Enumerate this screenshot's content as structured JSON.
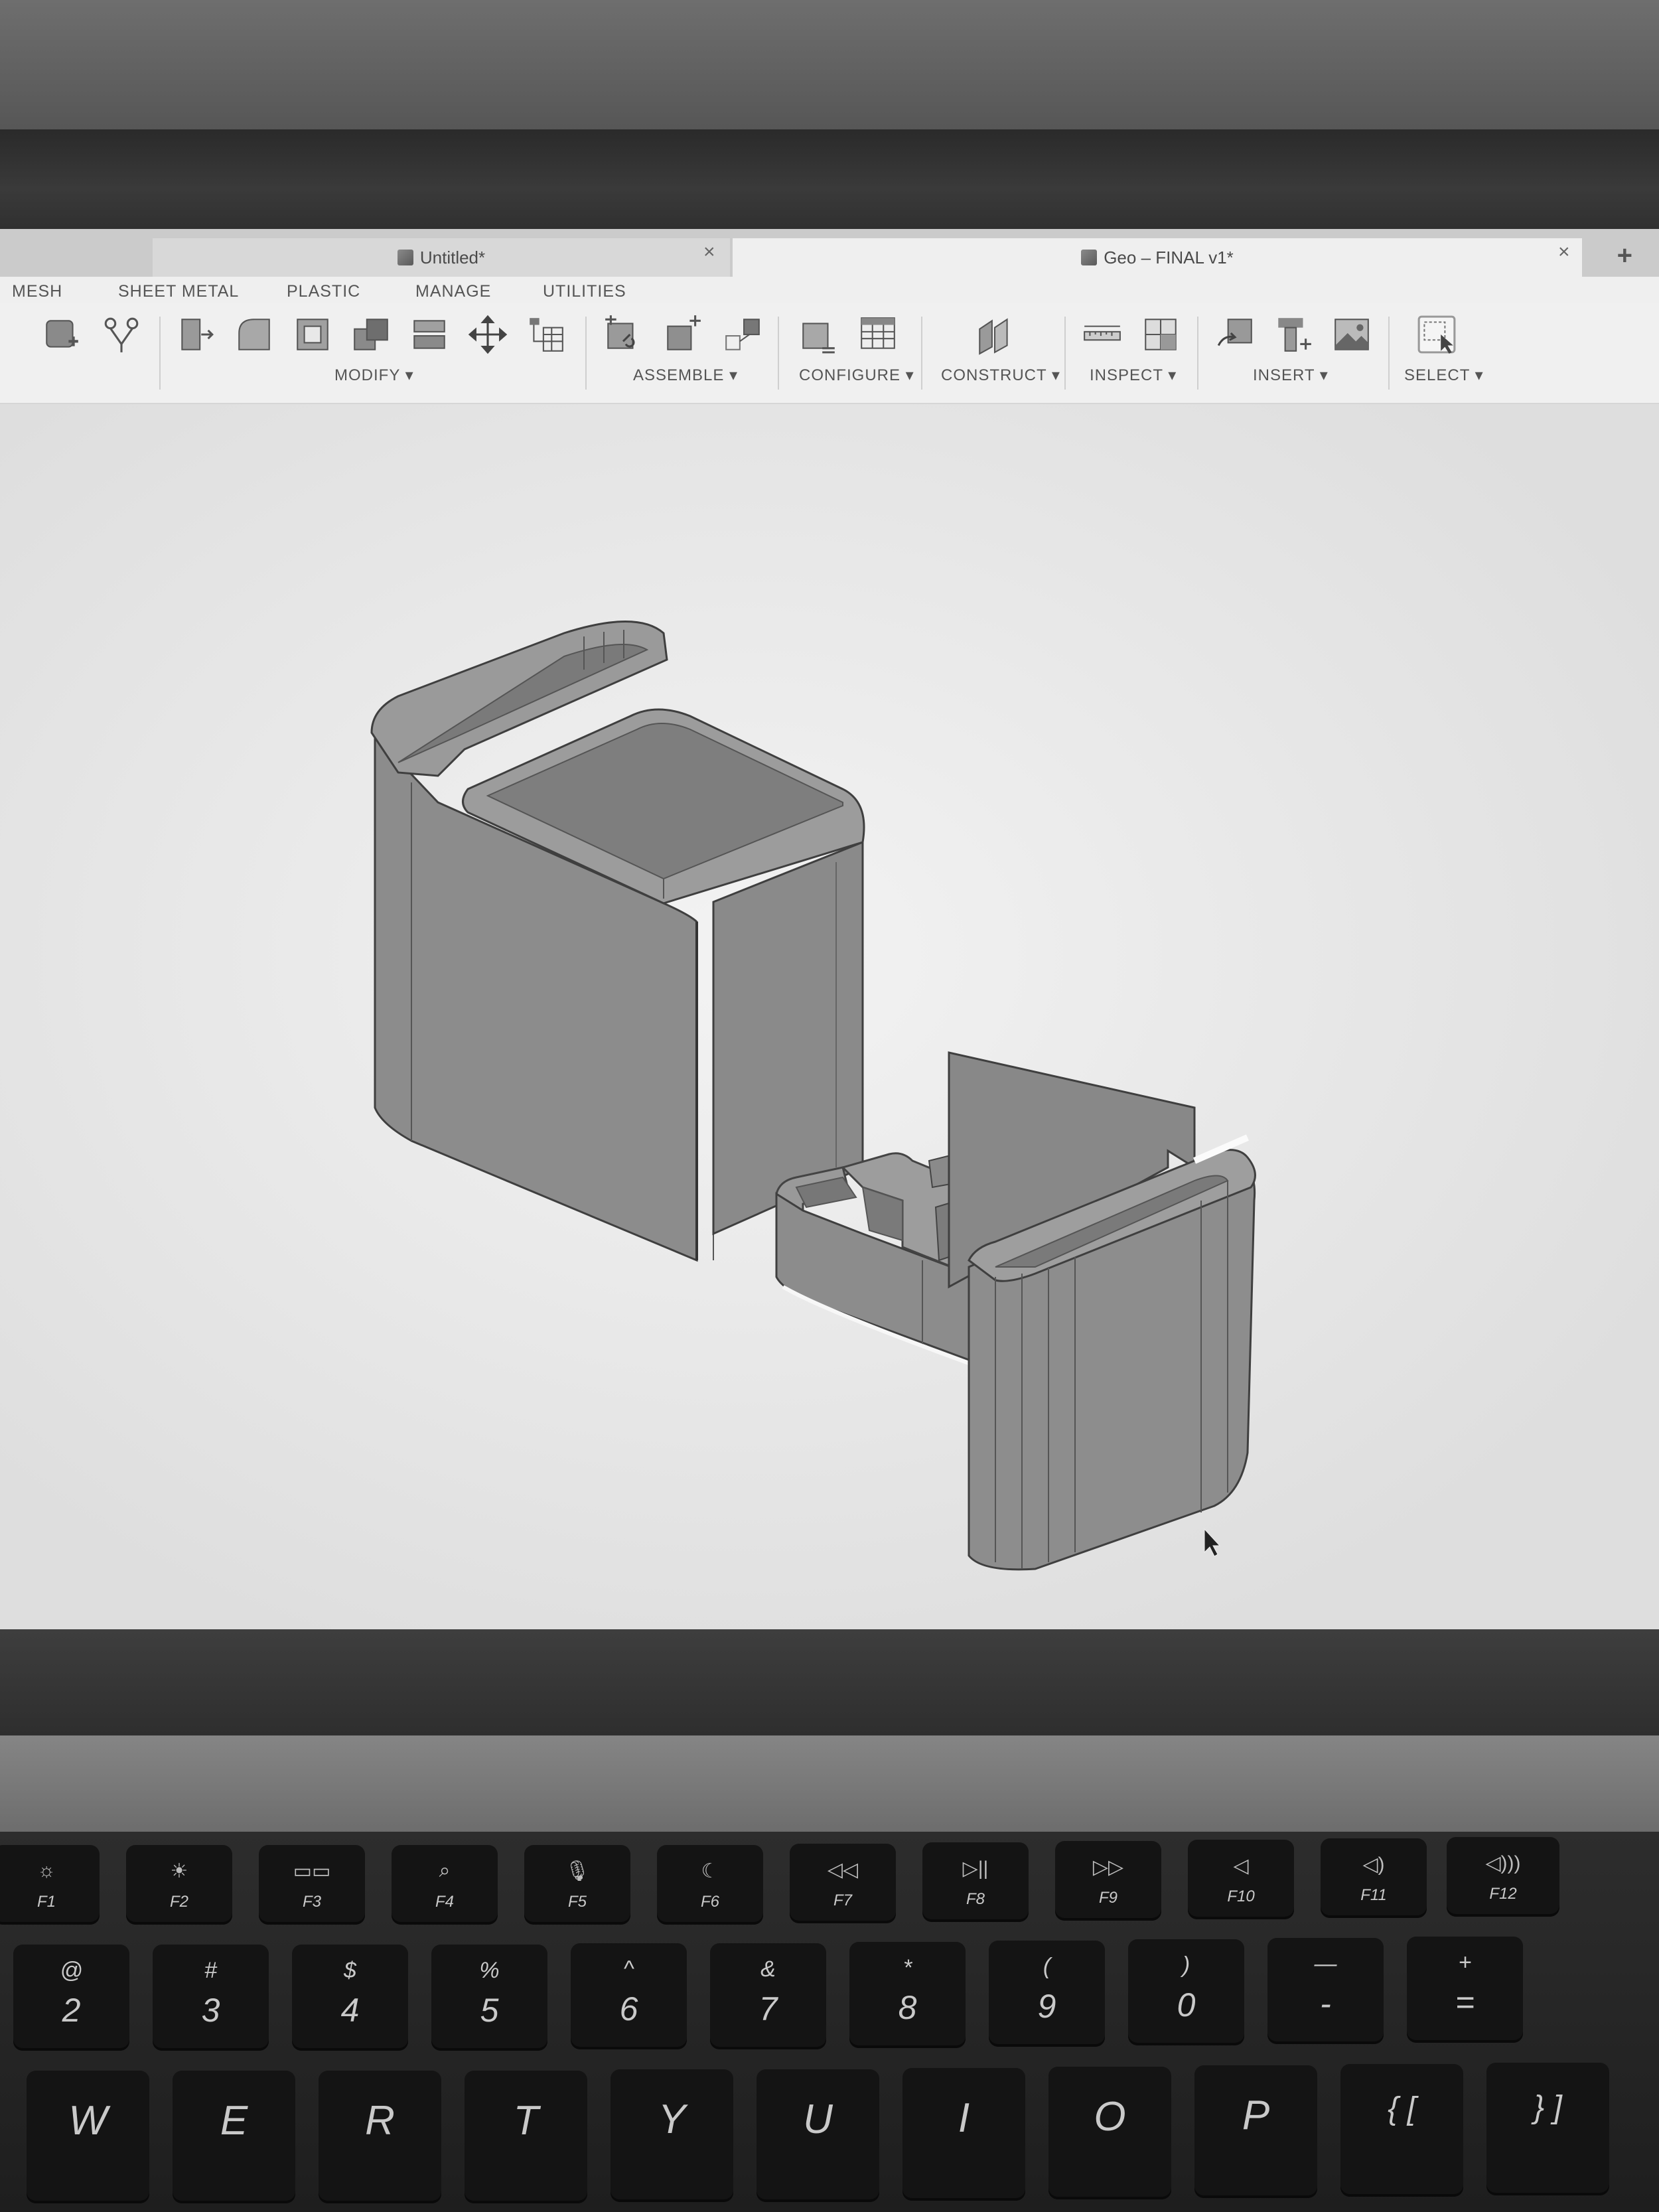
{
  "document_tabs": [
    {
      "title": "Untitled*",
      "active": false,
      "close_icon": "×"
    },
    {
      "title": "Geo – FINAL v1*",
      "active": true,
      "close_icon": "×"
    }
  ],
  "new_tab_icon": "+",
  "menu_tabs": [
    "MESH",
    "SHEET METAL",
    "PLASTIC",
    "MANAGE",
    "UTILITIES"
  ],
  "toolbar_groups": {
    "modify": "MODIFY ▾",
    "assemble": "ASSEMBLE ▾",
    "configure": "CONFIGURE ▾",
    "construct": "CONSTRUCT ▾",
    "inspect": "INSPECT ▾",
    "insert": "INSERT ▾",
    "select": "SELECT ▾"
  },
  "browser_add": "+",
  "navigation_icons": [
    "orbit",
    "look-at",
    "pan",
    "zoom",
    "fit",
    "display-settings",
    "grid",
    "viewports"
  ],
  "function_keys": [
    {
      "label": "F1",
      "glyph": "☼"
    },
    {
      "label": "F2",
      "glyph": "☀"
    },
    {
      "label": "F3",
      "glyph": "▭▭"
    },
    {
      "label": "F4",
      "glyph": "⌕"
    },
    {
      "label": "F5",
      "glyph": "🎙"
    },
    {
      "label": "F6",
      "glyph": "☾"
    },
    {
      "label": "F7",
      "glyph": "◁◁"
    },
    {
      "label": "F8",
      "glyph": "▷||"
    },
    {
      "label": "F9",
      "glyph": "▷▷"
    },
    {
      "label": "F10",
      "glyph": "◁"
    },
    {
      "label": "F11",
      "glyph": "◁)"
    },
    {
      "label": "F12",
      "glyph": "◁)))"
    }
  ],
  "number_keys": [
    {
      "top": "@",
      "main": "2"
    },
    {
      "top": "#",
      "main": "3"
    },
    {
      "top": "$",
      "main": "4"
    },
    {
      "top": "%",
      "main": "5"
    },
    {
      "top": "^",
      "main": "6"
    },
    {
      "top": "&",
      "main": "7"
    },
    {
      "top": "*",
      "main": "8"
    },
    {
      "top": "(",
      "main": "9"
    },
    {
      "top": ")",
      "main": "0"
    },
    {
      "top": "—",
      "main": "-"
    },
    {
      "top": "+",
      "main": "="
    }
  ],
  "letter_keys": [
    "W",
    "E",
    "R",
    "T",
    "Y",
    "U",
    "I",
    "O",
    "P",
    "{ [",
    "} ]"
  ],
  "colors": {
    "toolbar_bg": "#f0f0f0",
    "viewport_bg": "#e9e9e9",
    "model_gray": "#8f8f8f"
  }
}
